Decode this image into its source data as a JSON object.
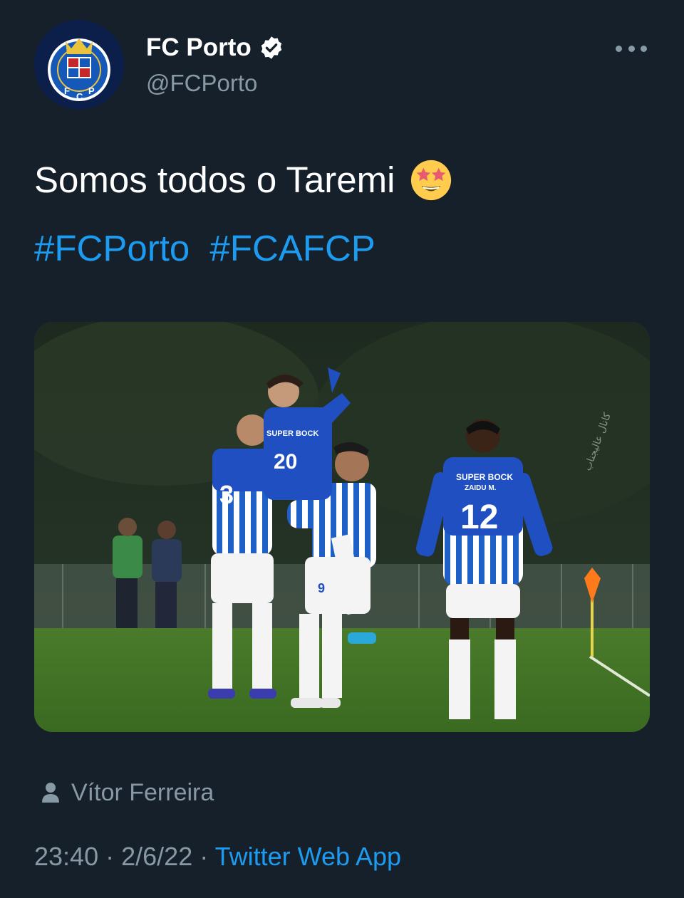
{
  "account": {
    "display_name": "FC Porto",
    "handle": "@FCPorto",
    "avatar_text": "F C P",
    "verified": true
  },
  "tweet": {
    "text": "Somos todos o Taremi",
    "emoji": "star-struck-emoji",
    "hashtags": [
      "#FCPorto",
      "#FCAFCP"
    ]
  },
  "media": {
    "jersey_texts": [
      "SUPER BOCK",
      "3",
      "20",
      "12",
      "9",
      "ZAIDU M."
    ],
    "watermark": "کانال عالیجناب"
  },
  "photo_credit": {
    "name": "Vítor Ferreira"
  },
  "meta": {
    "time": "23:40",
    "separator": "·",
    "date": "2/6/22",
    "source": "Twitter Web App"
  },
  "colors": {
    "background": "#15202b",
    "link": "#1d9bf0",
    "secondary_text": "#8899a6",
    "verified_badge": "#ffffff"
  }
}
